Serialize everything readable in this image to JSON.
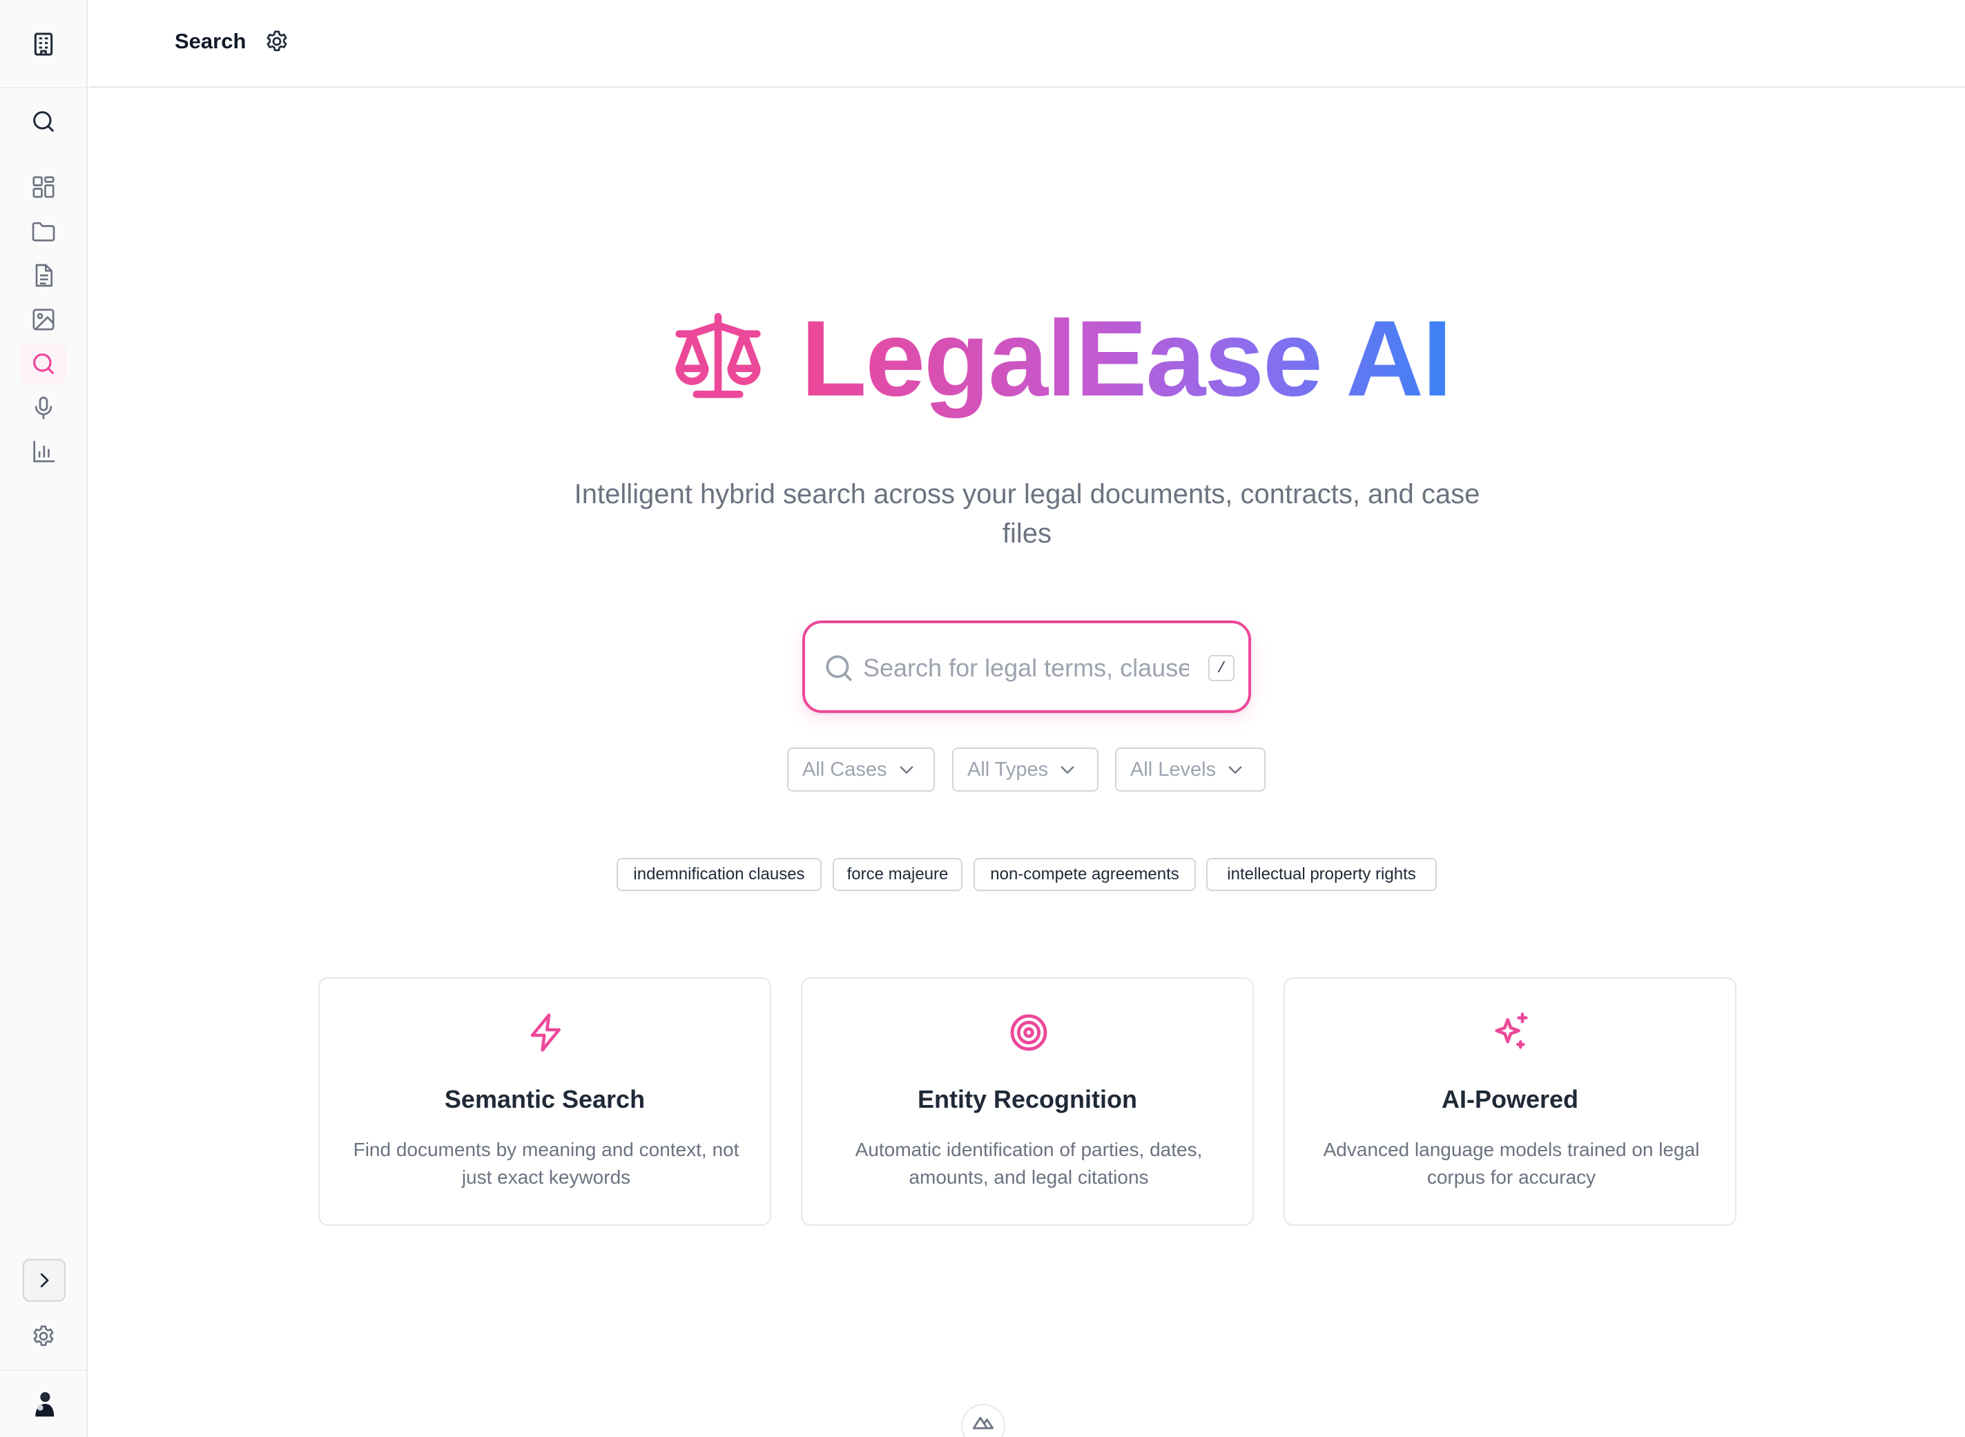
{
  "header": {
    "title": "Search",
    "settings_icon": "gear-icon"
  },
  "sidebar": {
    "items": [
      {
        "icon": "building-icon",
        "label": "Organization"
      },
      {
        "icon": "search-icon",
        "label": "Quick search"
      },
      {
        "icon": "dashboard-icon",
        "label": "Dashboard"
      },
      {
        "icon": "folder-icon",
        "label": "Cases"
      },
      {
        "icon": "document-icon",
        "label": "Documents"
      },
      {
        "icon": "image-icon",
        "label": "Images"
      },
      {
        "icon": "search-icon",
        "label": "Search",
        "active": true
      },
      {
        "icon": "microphone-icon",
        "label": "Transcription"
      },
      {
        "icon": "bar-chart-icon",
        "label": "Analytics"
      }
    ],
    "collapse_icon": "chevron-right-icon",
    "settings_icon": "gear-icon",
    "avatar_icon": "user-avatar-icon"
  },
  "hero": {
    "logo_icon": "scale-icon",
    "title": "LegalEase AI",
    "subtitle": "Intelligent hybrid search across your legal documents, contracts, and case files"
  },
  "search": {
    "placeholder": "Search for legal terms, clauses, or concepts",
    "value": "",
    "shortcut": "/"
  },
  "filters": [
    {
      "label": "All Cases"
    },
    {
      "label": "All Types"
    },
    {
      "label": "All Levels"
    }
  ],
  "suggestions": [
    "indemnification clauses",
    "force majeure",
    "non-compete agreements",
    "intellectual property rights"
  ],
  "features": [
    {
      "icon": "lightning-icon",
      "title": "Semantic Search",
      "description": "Find documents by meaning and context, not just exact keywords"
    },
    {
      "icon": "target-icon",
      "title": "Entity Recognition",
      "description": "Automatic identification of parties, dates, amounts, and legal citations"
    },
    {
      "icon": "sparkles-icon",
      "title": "AI-Powered",
      "description": "Advanced language models trained on legal corpus for accuracy"
    }
  ],
  "colors": {
    "accent": "#ec4899",
    "gradient_start": "#ec4899",
    "gradient_end": "#3b82f6",
    "muted_text": "#6b7280",
    "border": "#e5e7eb"
  }
}
